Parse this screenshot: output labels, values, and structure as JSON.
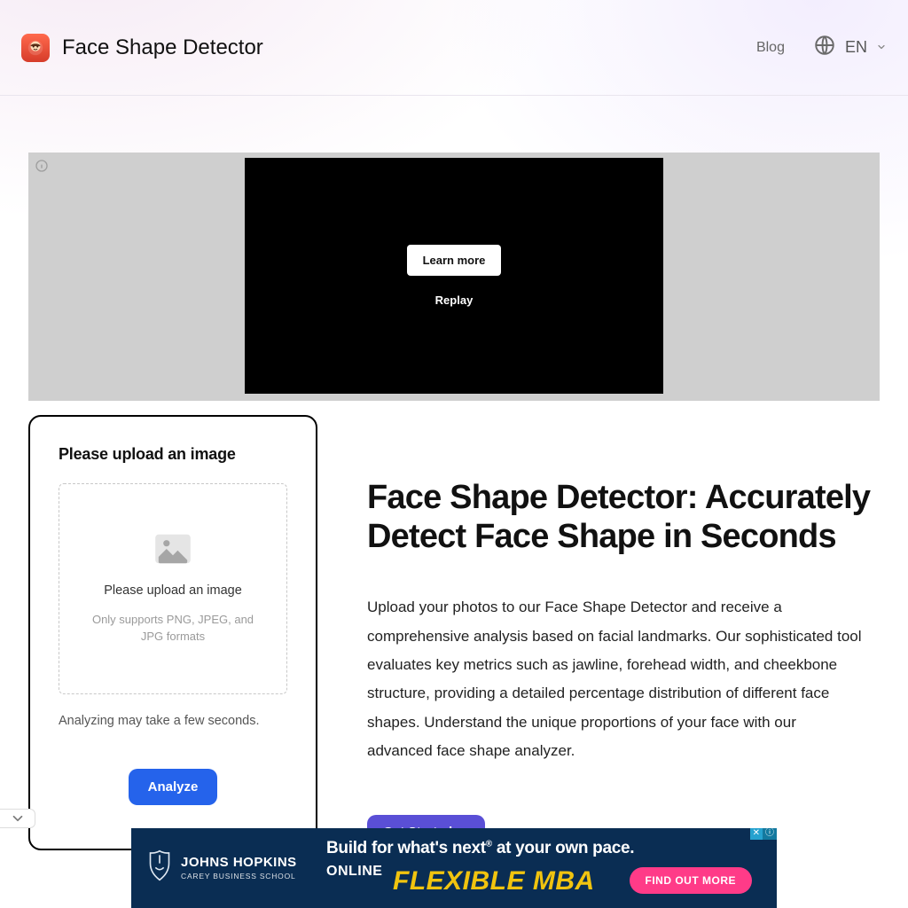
{
  "header": {
    "brand": "Face Shape Detector",
    "blog": "Blog",
    "lang": "EN"
  },
  "hero_ad": {
    "learn_more": "Learn more",
    "replay": "Replay"
  },
  "upload": {
    "title": "Please upload an image",
    "dz_line1": "Please upload an image",
    "dz_line2": "Only supports PNG, JPEG, and JPG formats",
    "note": "Analyzing may take a few seconds.",
    "analyze": "Analyze"
  },
  "copy": {
    "title": "Face Shape Detector: Accurately Detect Face Shape in Seconds",
    "body": "Upload your photos to our Face Shape Detector and receive a comprehensive analysis based on facial landmarks. Our sophisticated tool evaluates key metrics such as jawline, forehead width, and cheekbone structure, providing a detailed percentage distribution of different face shapes. Understand the unique proportions of your face with our advanced face shape analyzer.",
    "cta": "Get Started →"
  },
  "banner": {
    "school_line1": "JOHNS HOPKINS",
    "school_line2": "CAREY BUSINESS SCHOOL",
    "head1_a": "Build for what's next",
    "head1_sup": "®",
    "head1_b": " at your own pace.",
    "head2": "ONLINE",
    "flex": "FLEXIBLE MBA",
    "cta": "FIND OUT MORE"
  }
}
